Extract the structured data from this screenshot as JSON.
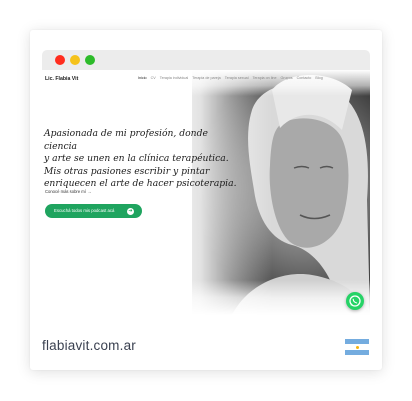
{
  "site": {
    "brand": "Lic. Flabia Vit",
    "nav": [
      "Inicio",
      "CV",
      "Terapia individual",
      "Terapia de pareja",
      "Terapia sexual",
      "Terapia on line",
      "Grupos",
      "Contacto",
      "Blog"
    ],
    "tagline_lines": [
      "Apasionada de mi profesión, donde ciencia",
      "y arte se unen en la clínica terapéutica.",
      "Mis otras pasiones escribir y pintar",
      "enriquecen el arte de hacer psicoterapia."
    ],
    "more_link": "Conocé más sobre mí →",
    "cta_label": "Escuchá todos mis podcast acá"
  },
  "footer": {
    "domain": "flabiavit.com.ar"
  },
  "icons": {
    "whatsapp": "whatsapp-icon",
    "flag": "argentina-flag-icon",
    "cta": "arrow-circle-icon"
  },
  "colors": {
    "cta_green": "#1fa45f",
    "whatsapp_green": "#25d366",
    "domain_text": "#3a4150",
    "flag_blue": "#74acdf",
    "flag_sun": "#f6b40e"
  }
}
